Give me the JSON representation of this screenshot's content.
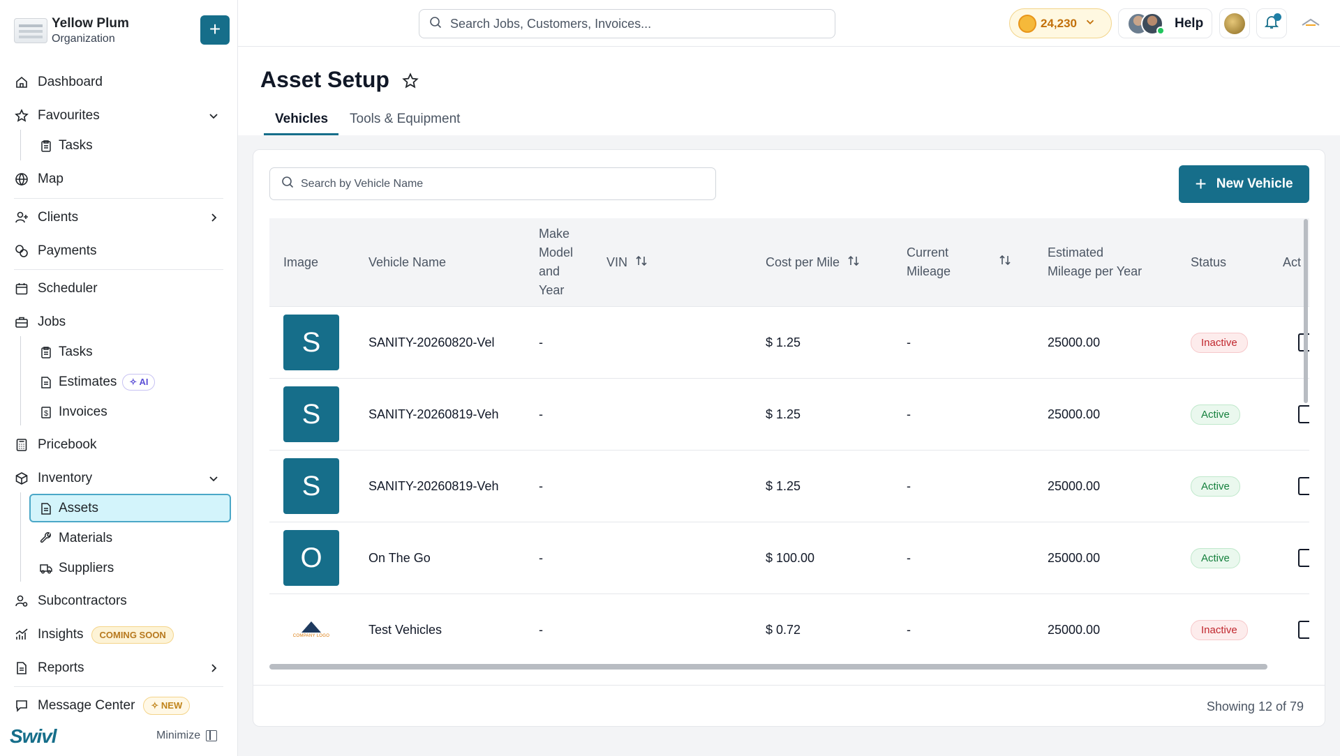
{
  "org": {
    "name": "Yellow Plum",
    "subtitle": "Organization"
  },
  "sidebar": {
    "dashboard": "Dashboard",
    "favourites": "Favourites",
    "fav_tasks": "Tasks",
    "map": "Map",
    "clients": "Clients",
    "payments": "Payments",
    "scheduler": "Scheduler",
    "jobs": "Jobs",
    "jobs_tasks": "Tasks",
    "estimates": "Estimates",
    "estimates_badge": "AI",
    "invoices": "Invoices",
    "pricebook": "Pricebook",
    "inventory": "Inventory",
    "assets": "Assets",
    "materials": "Materials",
    "suppliers": "Suppliers",
    "subcontractors": "Subcontractors",
    "insights": "Insights",
    "insights_badge": "COMING SOON",
    "reports": "Reports",
    "message_center": "Message Center",
    "message_center_badge": "NEW",
    "brand": "Swivl",
    "minimize": "Minimize"
  },
  "topbar": {
    "search_placeholder": "Search Jobs, Customers, Invoices...",
    "coins": "24,230",
    "help": "Help"
  },
  "page": {
    "title": "Asset Setup",
    "tabs": [
      "Vehicles",
      "Tools & Equipment"
    ],
    "active_tab": "Vehicles",
    "search_placeholder": "Search by Vehicle Name",
    "new_button": "New Vehicle",
    "showing": "Showing 12 of 79"
  },
  "table": {
    "headers": {
      "image": "Image",
      "vehicle_name": "Vehicle Name",
      "make_line1": "Make",
      "make_line2": "Model",
      "make_line3": "and",
      "make_line4": "Year",
      "vin": "VIN",
      "cost": "Cost per Mile",
      "mileage_line1": "Current",
      "mileage_line2": "Mileage",
      "est_line1": "Estimated",
      "est_line2": "Mileage per Year",
      "status": "Status",
      "actions": "Act"
    },
    "rows": [
      {
        "image_letter": "S",
        "name": "SANITY-20260820-Vel",
        "make": "-",
        "cost": "$ 1.25",
        "mileage": "-",
        "estimated": "25000.00",
        "status": "Inactive"
      },
      {
        "image_letter": "S",
        "name": "SANITY-20260819-Veh",
        "make": "-",
        "cost": "$ 1.25",
        "mileage": "-",
        "estimated": "25000.00",
        "status": "Active"
      },
      {
        "image_letter": "S",
        "name": "SANITY-20260819-Veh",
        "make": "-",
        "cost": "$ 1.25",
        "mileage": "-",
        "estimated": "25000.00",
        "status": "Active"
      },
      {
        "image_letter": "O",
        "name": "On The Go",
        "make": "-",
        "cost": "$ 100.00",
        "mileage": "-",
        "estimated": "25000.00",
        "status": "Active"
      },
      {
        "image_letter": "",
        "image_logo_text": "COMPANY LOGO",
        "name": "Test Vehicles",
        "make": "-",
        "cost": "$ 0.72",
        "mileage": "-",
        "estimated": "25000.00",
        "status": "Inactive"
      }
    ]
  },
  "colors": {
    "primary": "#166e8a",
    "active_nav_bg": "#d3f4fb",
    "inactive": "#c0262d",
    "active": "#15803d"
  }
}
